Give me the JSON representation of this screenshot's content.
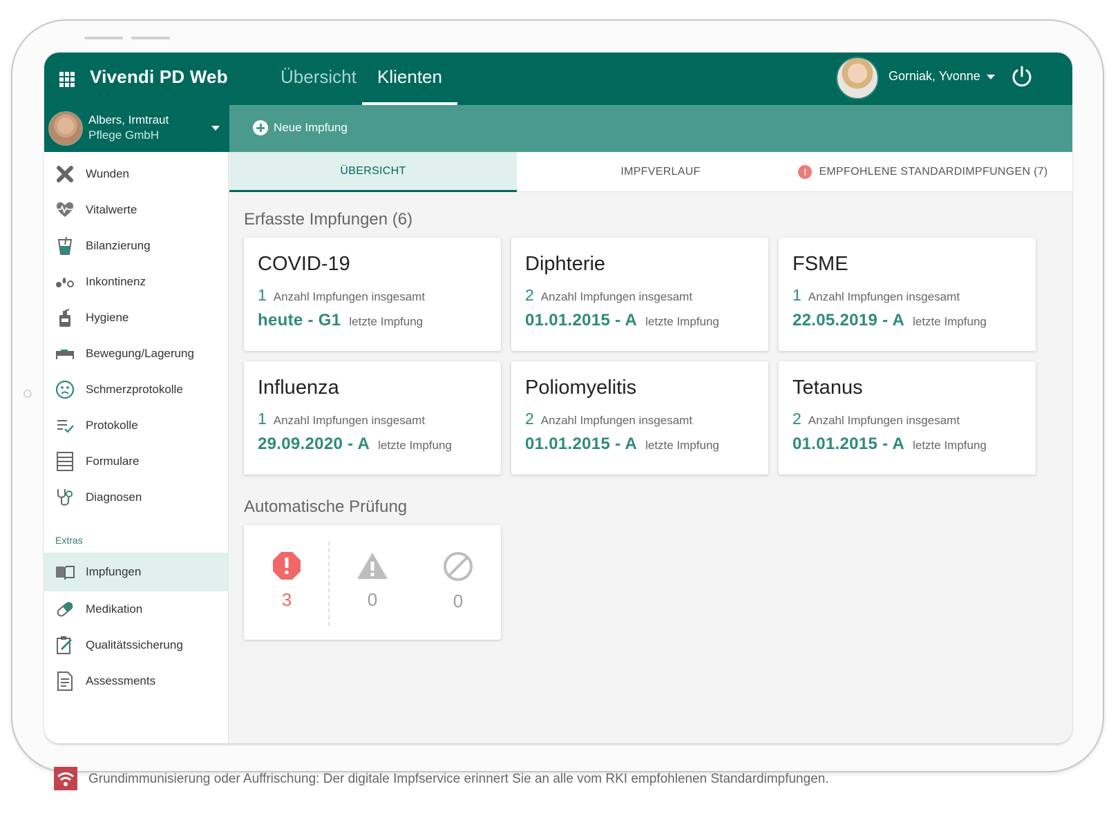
{
  "app": {
    "title": "Vivendi PD Web",
    "tabs": [
      {
        "label": "Übersicht",
        "active": false
      },
      {
        "label": "Klienten",
        "active": true
      }
    ],
    "user": {
      "name": "Gorniak, Yvonne"
    },
    "accent_color": "#00695c"
  },
  "client": {
    "name": "Albers, Irmtraut",
    "organization": "Pflege GmbH"
  },
  "toolbar": {
    "new_vaccination_label": "Neue Impfung"
  },
  "sidebar": {
    "items": [
      {
        "label": "Wunden",
        "icon": "wound-icon"
      },
      {
        "label": "Vitalwerte",
        "icon": "heart-pulse-icon"
      },
      {
        "label": "Bilanzierung",
        "icon": "drink-icon"
      },
      {
        "label": "Inkontinenz",
        "icon": "drops-icon"
      },
      {
        "label": "Hygiene",
        "icon": "soap-bottle-icon"
      },
      {
        "label": "Bewegung/Lagerung",
        "icon": "bed-icon"
      },
      {
        "label": "Schmerzprotokolle",
        "icon": "sad-face-icon"
      },
      {
        "label": "Protokolle",
        "icon": "checklist-icon"
      },
      {
        "label": "Formulare",
        "icon": "form-icon"
      },
      {
        "label": "Diagnosen",
        "icon": "stethoscope-icon"
      }
    ],
    "extras_heading": "Extras",
    "extras": [
      {
        "label": "Impfungen",
        "icon": "book-icon",
        "active": true
      },
      {
        "label": "Medikation",
        "icon": "pill-icon",
        "active": false
      },
      {
        "label": "Qualitätssicherung",
        "icon": "clipboard-edit-icon",
        "active": false
      },
      {
        "label": "Assessments",
        "icon": "document-icon",
        "active": false
      }
    ]
  },
  "content_tabs": [
    {
      "label": "ÜBERSICHT",
      "active": true
    },
    {
      "label": "IMPFVERLAUF",
      "active": false
    },
    {
      "label": "EMPFOHLENE STANDARDIMPFUNGEN (7)",
      "active": false,
      "alert": "!"
    }
  ],
  "vaccinations": {
    "heading": "Erfasste Impfungen (6)",
    "count_label": "Anzahl Impfungen insgesamt",
    "last_label": "letzte Impfung",
    "cards": [
      {
        "title": "COVID-19",
        "count": "1",
        "last": "heute - G1"
      },
      {
        "title": "Diphterie",
        "count": "2",
        "last": "01.01.2015 - A"
      },
      {
        "title": "FSME",
        "count": "1",
        "last": "22.05.2019 - A"
      },
      {
        "title": "Influenza",
        "count": "1",
        "last": "29.09.2020 - A"
      },
      {
        "title": "Poliomyelitis",
        "count": "2",
        "last": "01.01.2015 - A"
      },
      {
        "title": "Tetanus",
        "count": "2",
        "last": "01.01.2015 - A"
      }
    ]
  },
  "auto_check": {
    "heading": "Automatische Prüfung",
    "errors": "3",
    "warnings": "0",
    "blocked": "0",
    "error_color": "#f06868",
    "neutral_color": "#bdbdbd"
  },
  "caption": {
    "text": "Grundimmunisierung oder Auffrischung: Der digitale Impfservice erinnert Sie an alle vom RKI empfohlenen Standardimpfungen."
  }
}
